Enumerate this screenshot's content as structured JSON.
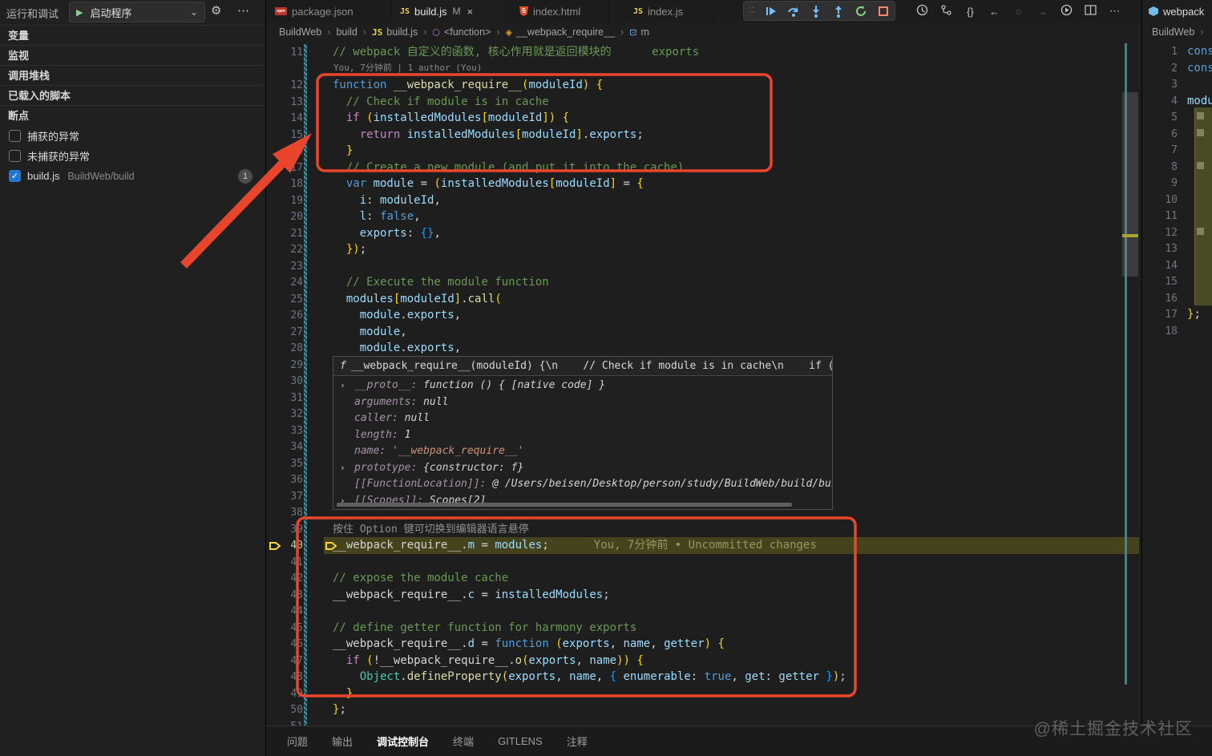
{
  "sidebar": {
    "title": "运行和调试",
    "launch_label": "启动程序",
    "sections": [
      "变量",
      "监视",
      "调用堆栈",
      "已载入的脚本",
      "断点"
    ],
    "breakpoints": [
      {
        "label": "捕获的异常",
        "checked": false
      },
      {
        "label": "未捕获的异常",
        "checked": false
      },
      {
        "label": "build.js",
        "path": "BuildWeb/build",
        "checked": true,
        "badge": "1"
      }
    ]
  },
  "tabs": [
    {
      "label": "package.json",
      "icon": "npm",
      "active": false
    },
    {
      "label": "build.js",
      "icon": "js",
      "modified": "M",
      "close": "×",
      "active": true
    },
    {
      "label": "index.html",
      "icon": "html",
      "active": false
    },
    {
      "label": "index.js",
      "icon": "js",
      "active": false
    }
  ],
  "breadcrumb": {
    "items": [
      "BuildWeb",
      "build",
      "build.js",
      "<function>",
      "__webpack_require__",
      "m"
    ],
    "sep": "›"
  },
  "debug_toolbar": [
    "continue",
    "step-over",
    "step-into",
    "step-out",
    "restart",
    "stop"
  ],
  "editor": {
    "codelens": "You, 7分钟前 | 1 author (You)",
    "hover_hint": "按住 Option 键可切换到编辑器语言悬停",
    "blame": "You, 7分钟前 • Uncommitted changes",
    "lines": [
      {
        "n": 11,
        "t": [
          [
            "c",
            "// webpack 自定义的函数, 核心作用就是返回模块的      exports"
          ]
        ]
      },
      {
        "n": 12,
        "t": [
          [
            "k",
            "function "
          ],
          [
            "f",
            "__webpack_require__"
          ],
          [
            "b",
            "("
          ],
          [
            "v",
            "moduleId"
          ],
          [
            "b",
            ") "
          ],
          [
            "b",
            "{"
          ]
        ]
      },
      {
        "n": 13,
        "t": [
          [
            "ws",
            "  "
          ],
          [
            "c",
            "// Check if module is in cache"
          ]
        ]
      },
      {
        "n": 14,
        "t": [
          [
            "ws",
            "  "
          ],
          [
            "ctrl",
            "if "
          ],
          [
            "b",
            "("
          ],
          [
            "v",
            "installedModules"
          ],
          [
            "b",
            "["
          ],
          [
            "v",
            "moduleId"
          ],
          [
            "b",
            "]"
          ],
          [
            "b",
            ") "
          ],
          [
            "b",
            "{"
          ]
        ]
      },
      {
        "n": 15,
        "t": [
          [
            "ws",
            "    "
          ],
          [
            "ctrl",
            "return "
          ],
          [
            "v",
            "installedModules"
          ],
          [
            "b",
            "["
          ],
          [
            "v",
            "moduleId"
          ],
          [
            "b",
            "]"
          ],
          [
            "p",
            "."
          ],
          [
            "v",
            "exports"
          ],
          [
            "p",
            ";"
          ]
        ]
      },
      {
        "n": 16,
        "t": [
          [
            "ws",
            "  "
          ],
          [
            "b",
            "}"
          ]
        ]
      },
      {
        "n": 17,
        "t": [
          [
            "ws",
            "  "
          ],
          [
            "c",
            "// Create a new module (and put it into the cache)"
          ]
        ]
      },
      {
        "n": 18,
        "t": [
          [
            "ws",
            "  "
          ],
          [
            "k",
            "var "
          ],
          [
            "v",
            "module"
          ],
          [
            "p",
            " = "
          ],
          [
            "b",
            "("
          ],
          [
            "v",
            "installedModules"
          ],
          [
            "b",
            "["
          ],
          [
            "v",
            "moduleId"
          ],
          [
            "b",
            "]"
          ],
          [
            "p",
            " = "
          ],
          [
            "b",
            "{"
          ]
        ]
      },
      {
        "n": 19,
        "t": [
          [
            "ws",
            "    "
          ],
          [
            "v",
            "i"
          ],
          [
            "p",
            ": "
          ],
          [
            "v",
            "moduleId"
          ],
          [
            "p",
            ","
          ]
        ]
      },
      {
        "n": 20,
        "t": [
          [
            "ws",
            "    "
          ],
          [
            "v",
            "l"
          ],
          [
            "p",
            ": "
          ],
          [
            "k",
            "false"
          ],
          [
            "p",
            ","
          ]
        ]
      },
      {
        "n": 21,
        "t": [
          [
            "ws",
            "    "
          ],
          [
            "v",
            "exports"
          ],
          [
            "p",
            ": "
          ],
          [
            "b2",
            "{}"
          ],
          [
            "p",
            ","
          ]
        ]
      },
      {
        "n": 22,
        "t": [
          [
            "ws",
            "  "
          ],
          [
            "b",
            "})"
          ],
          [
            "p",
            ";"
          ]
        ]
      },
      {
        "n": 23,
        "t": []
      },
      {
        "n": 24,
        "t": [
          [
            "ws",
            "  "
          ],
          [
            "c",
            "// Execute the module function"
          ]
        ]
      },
      {
        "n": 25,
        "t": [
          [
            "ws",
            "  "
          ],
          [
            "v",
            "modules"
          ],
          [
            "b",
            "["
          ],
          [
            "v",
            "moduleId"
          ],
          [
            "b",
            "]"
          ],
          [
            "p",
            "."
          ],
          [
            "f",
            "call"
          ],
          [
            "b",
            "("
          ]
        ]
      },
      {
        "n": 26,
        "t": [
          [
            "ws",
            "    "
          ],
          [
            "v",
            "module"
          ],
          [
            "p",
            "."
          ],
          [
            "v",
            "exports"
          ],
          [
            "p",
            ","
          ]
        ]
      },
      {
        "n": 27,
        "t": [
          [
            "ws",
            "    "
          ],
          [
            "v",
            "module"
          ],
          [
            "p",
            ","
          ]
        ]
      },
      {
        "n": 28,
        "t": [
          [
            "ws",
            "    "
          ],
          [
            "v",
            "module"
          ],
          [
            "p",
            "."
          ],
          [
            "v",
            "exports"
          ],
          [
            "p",
            ","
          ]
        ]
      },
      {
        "n": 29,
        "t": []
      },
      {
        "n": 30,
        "t": []
      },
      {
        "n": 31,
        "t": []
      },
      {
        "n": 32,
        "t": []
      },
      {
        "n": 33,
        "t": []
      },
      {
        "n": 34,
        "t": []
      },
      {
        "n": 35,
        "t": []
      },
      {
        "n": 36,
        "t": []
      },
      {
        "n": 37,
        "t": []
      },
      {
        "n": 38,
        "t": []
      },
      {
        "n": 39,
        "t": [],
        "hint": true
      },
      {
        "n": 40,
        "t": [
          [
            "id",
            "__webpack_require__"
          ],
          [
            "p",
            "."
          ],
          [
            "v",
            "m"
          ],
          [
            "p",
            " = "
          ],
          [
            "v",
            "modules"
          ],
          [
            "p",
            ";"
          ]
        ],
        "current": true
      },
      {
        "n": 41,
        "t": []
      },
      {
        "n": 42,
        "t": [
          [
            "c",
            "// expose the module cache"
          ]
        ]
      },
      {
        "n": 43,
        "t": [
          [
            "id",
            "__webpack_require__"
          ],
          [
            "p",
            "."
          ],
          [
            "v",
            "c"
          ],
          [
            "p",
            " = "
          ],
          [
            "v",
            "installedModules"
          ],
          [
            "p",
            ";"
          ]
        ]
      },
      {
        "n": 44,
        "t": []
      },
      {
        "n": 45,
        "t": [
          [
            "c",
            "// define getter function for harmony exports"
          ]
        ]
      },
      {
        "n": 46,
        "t": [
          [
            "id",
            "__webpack_require__"
          ],
          [
            "p",
            "."
          ],
          [
            "v",
            "d"
          ],
          [
            "p",
            " = "
          ],
          [
            "k",
            "function "
          ],
          [
            "b",
            "("
          ],
          [
            "v",
            "exports"
          ],
          [
            "p",
            ", "
          ],
          [
            "v",
            "name"
          ],
          [
            "p",
            ", "
          ],
          [
            "v",
            "getter"
          ],
          [
            "b",
            ") "
          ],
          [
            "b",
            "{"
          ]
        ]
      },
      {
        "n": 47,
        "t": [
          [
            "ws",
            "  "
          ],
          [
            "ctrl",
            "if "
          ],
          [
            "b",
            "("
          ],
          [
            "p",
            "!"
          ],
          [
            "id",
            "__webpack_require__"
          ],
          [
            "p",
            "."
          ],
          [
            "f",
            "o"
          ],
          [
            "b",
            "("
          ],
          [
            "v",
            "exports"
          ],
          [
            "p",
            ", "
          ],
          [
            "v",
            "name"
          ],
          [
            "b",
            "))"
          ],
          [
            "p",
            " "
          ],
          [
            "b",
            "{"
          ]
        ]
      },
      {
        "n": 48,
        "t": [
          [
            "ws",
            "    "
          ],
          [
            "cls",
            "Object"
          ],
          [
            "p",
            "."
          ],
          [
            "f",
            "defineProperty"
          ],
          [
            "b",
            "("
          ],
          [
            "v",
            "exports"
          ],
          [
            "p",
            ", "
          ],
          [
            "v",
            "name"
          ],
          [
            "p",
            ", "
          ],
          [
            "b2",
            "{ "
          ],
          [
            "v",
            "enumerable"
          ],
          [
            "p",
            ": "
          ],
          [
            "k",
            "true"
          ],
          [
            "p",
            ", "
          ],
          [
            "v",
            "get"
          ],
          [
            "p",
            ": "
          ],
          [
            "v",
            "getter"
          ],
          [
            "b2",
            " }"
          ],
          [
            "b",
            ")"
          ],
          [
            "p",
            ";"
          ]
        ]
      },
      {
        "n": 49,
        "t": [
          [
            "ws",
            "  "
          ],
          [
            "b",
            "}"
          ]
        ]
      },
      {
        "n": 50,
        "t": [
          [
            "b",
            "}"
          ],
          [
            "p",
            ";"
          ]
        ]
      },
      {
        "n": 51,
        "t": []
      }
    ]
  },
  "popup": {
    "header": "f __webpack_require__(moduleId) {\\n    // Check if module is in cache\\n    if (…",
    "rows": [
      {
        "expand": true,
        "name": "__proto__",
        "value": "function () { [native code] }",
        "type": "fn"
      },
      {
        "expand": false,
        "name": "arguments",
        "value": "null",
        "type": "plain"
      },
      {
        "expand": false,
        "name": "caller",
        "value": "null",
        "type": "plain"
      },
      {
        "expand": false,
        "name": "length",
        "value": "1",
        "type": "plain"
      },
      {
        "expand": false,
        "name": "name",
        "value": "'__webpack_require__'",
        "type": "str"
      },
      {
        "expand": true,
        "name": "prototype",
        "value": "{constructor: f}",
        "type": "plain"
      },
      {
        "expand": false,
        "name": "[[FunctionLocation]]",
        "value": "@ /Users/beisen/Desktop/person/study/BuildWeb/build/build",
        "type": "plain"
      },
      {
        "expand": true,
        "name": "[[Scopes]]",
        "value": "Scopes[2]",
        "type": "plain"
      }
    ]
  },
  "right_pane": {
    "tab": "webpack",
    "breadcrumb": "BuildWeb",
    "crumb_sep": "›",
    "lines": [
      {
        "n": 1,
        "t": [
          [
            "k",
            "const"
          ]
        ]
      },
      {
        "n": 2,
        "t": [
          [
            "k",
            "const"
          ]
        ]
      },
      {
        "n": 3,
        "t": []
      },
      {
        "n": 4,
        "t": [
          [
            "v",
            "modules"
          ]
        ]
      },
      {
        "n": 5,
        "t": []
      },
      {
        "n": 6,
        "t": []
      },
      {
        "n": 7,
        "t": []
      },
      {
        "n": 8,
        "t": []
      },
      {
        "n": 9,
        "t": []
      },
      {
        "n": 10,
        "t": []
      },
      {
        "n": 11,
        "t": []
      },
      {
        "n": 12,
        "t": []
      },
      {
        "n": 13,
        "t": []
      },
      {
        "n": 14,
        "t": []
      },
      {
        "n": 15,
        "t": []
      },
      {
        "n": 16,
        "t": []
      },
      {
        "n": 17,
        "t": [
          [
            "b",
            "}"
          ],
          [
            "p",
            ";"
          ]
        ]
      },
      {
        "n": 18,
        "t": []
      }
    ]
  },
  "panel_tabs": [
    {
      "label": "问题",
      "active": false
    },
    {
      "label": "输出",
      "active": false
    },
    {
      "label": "调试控制台",
      "active": true
    },
    {
      "label": "终端",
      "active": false
    },
    {
      "label": "GITLENS",
      "active": false
    },
    {
      "label": "注释",
      "active": false
    }
  ],
  "watermark": "@稀土掘金技术社区"
}
